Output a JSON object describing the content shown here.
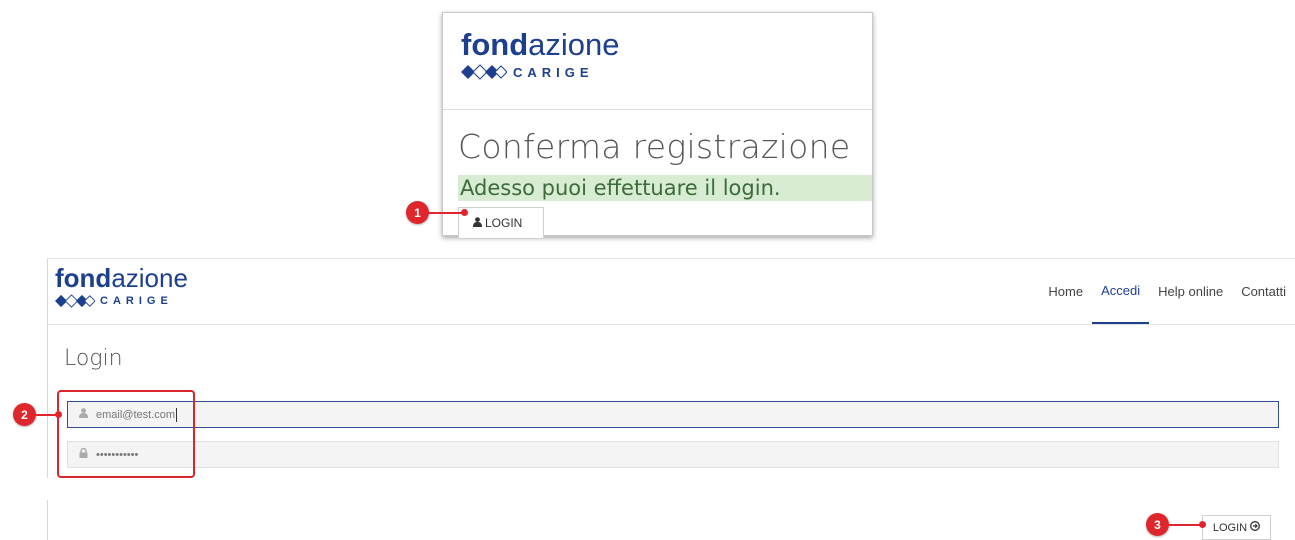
{
  "brand": {
    "name_bold": "fond",
    "name_light": "azione",
    "subtitle": "CARIGE",
    "color": "#1c3f8f"
  },
  "confirm_card": {
    "title": "Conferma registrazione",
    "message": "Adesso puoi effettuare il login.",
    "login_button": "LOGIN",
    "login_icon": "user-icon"
  },
  "nav": {
    "items": [
      "Home",
      "Accedi",
      "Help online",
      "Contatti"
    ],
    "active": "Accedi"
  },
  "login_form": {
    "title": "Login",
    "email": {
      "value": "email@test.com",
      "icon": "user-icon"
    },
    "password": {
      "value": "•••••••••••",
      "icon": "lock-icon"
    },
    "submit_label": "LOGIN",
    "submit_icon": "arrow-circle-right-icon"
  },
  "annotations": {
    "markers": [
      "1",
      "2",
      "3"
    ],
    "color": "#e0262d"
  }
}
